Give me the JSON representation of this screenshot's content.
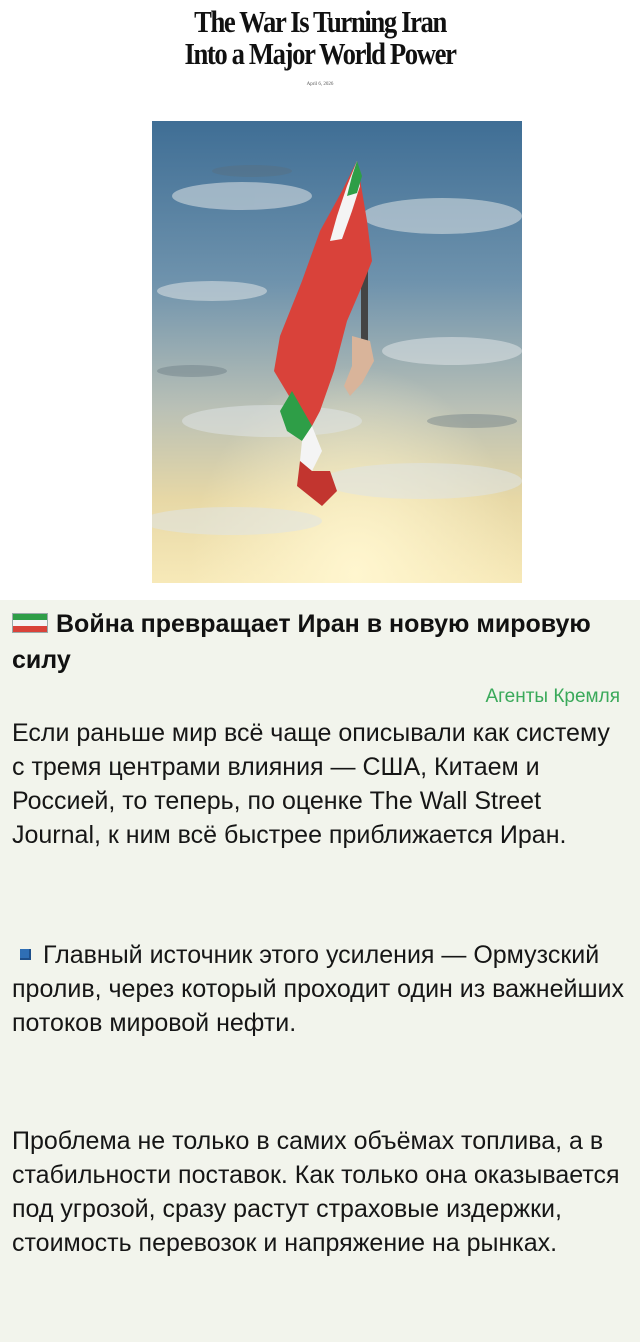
{
  "article": {
    "headline_line1": "The War Is Turning Iran",
    "headline_line2": "Into a Major World Power",
    "date": "April 6, 2026"
  },
  "post": {
    "flag_icon": "iran-flag-icon",
    "title": "Война превращает Иран в новую мировую силу",
    "signature": "Агенты Кремля",
    "paragraph1": "Если раньше мир всё чаще описывали как систему с тремя центрами влияния — США, Китаем и Россией, то теперь, по оценке The Wall Street Journal, к ним всё быстрее приближается Иран.",
    "bullet_icon": "blue-square-icon",
    "paragraph2": "Главный источник этого усиления — Ормузский пролив, через который проходит один из важнейших потоков мировой нефти.",
    "paragraph3": "Проблема не только в самих объёмах топлива, а в стабильности поставок. Как только она оказывается под угрозой, сразу растут страховые издержки, стоимость перевозок и напряжение на рынках."
  },
  "colors": {
    "signature": "#3aa95a",
    "flag_green": "#2e9e47",
    "flag_white": "#f4f4f4",
    "flag_red": "#d9423a",
    "bullet_blue": "#2f6fb5"
  }
}
